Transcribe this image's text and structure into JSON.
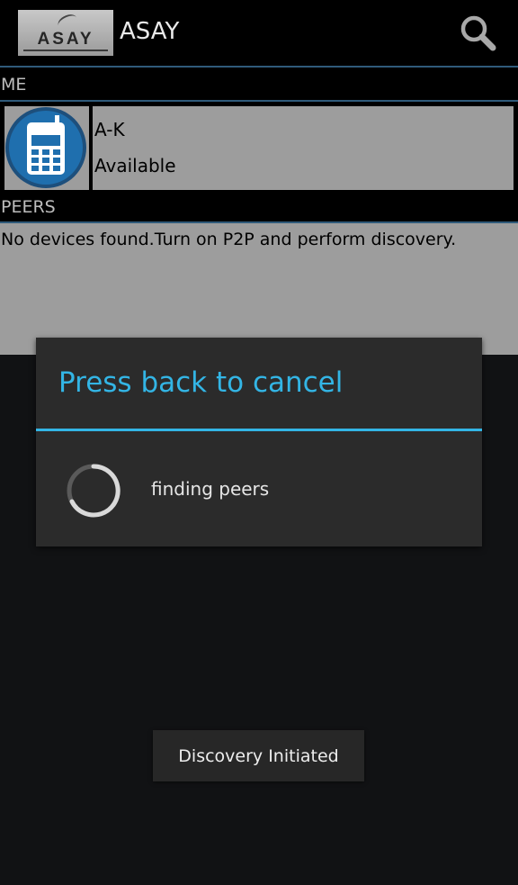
{
  "action_bar": {
    "logo_text": "ASAY",
    "title": "ASAY",
    "search_icon": "search-icon"
  },
  "me_section": {
    "header": "ME",
    "device": {
      "icon": "mobile-phone-icon",
      "name": "A-K",
      "status": "Available"
    }
  },
  "peers_section": {
    "header": "PEERS",
    "empty_message": "No devices found.Turn on P2P and perform discovery."
  },
  "progress_dialog": {
    "title": "Press back to cancel",
    "message": "finding peers",
    "spinner_icon": "progress-spinner-icon"
  },
  "toast": {
    "message": "Discovery Initiated"
  },
  "colors": {
    "accent": "#33b5e5",
    "background": "#111214",
    "action_bar": "#000000",
    "list_background": "#9d9d9d",
    "avatar_blue": "#1f6fae"
  }
}
